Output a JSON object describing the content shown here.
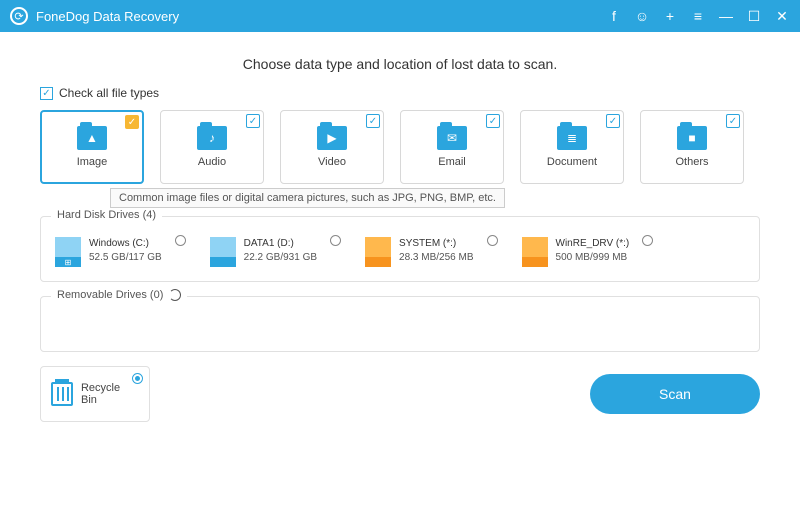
{
  "titlebar": {
    "app_name": "FoneDog Data Recovery"
  },
  "heading": "Choose data type and location of lost data to scan.",
  "check_all_label": "Check all file types",
  "types": [
    {
      "label": "Image",
      "glyph": "▲",
      "selected": true
    },
    {
      "label": "Audio",
      "glyph": "♪",
      "selected": false
    },
    {
      "label": "Video",
      "glyph": "▶",
      "selected": false
    },
    {
      "label": "Email",
      "glyph": "✉",
      "selected": false
    },
    {
      "label": "Document",
      "glyph": "≣",
      "selected": false
    },
    {
      "label": "Others",
      "glyph": "■",
      "selected": false
    }
  ],
  "tooltip": "Common image files or digital camera pictures, such as JPG, PNG, BMP, etc.",
  "hdd": {
    "title": "Hard Disk Drives (4)",
    "drives": [
      {
        "name": "Windows (C:)",
        "size": "52.5 GB/117 GB",
        "color": "blue",
        "badge": "⊞"
      },
      {
        "name": "DATA1 (D:)",
        "size": "22.2 GB/931 GB",
        "color": "blue",
        "badge": ""
      },
      {
        "name": "SYSTEM (*:)",
        "size": "28.3 MB/256 MB",
        "color": "orange",
        "badge": ""
      },
      {
        "name": "WinRE_DRV (*:)",
        "size": "500 MB/999 MB",
        "color": "orange",
        "badge": ""
      }
    ]
  },
  "removable": {
    "title": "Removable Drives (0)"
  },
  "recycle_label": "Recycle Bin",
  "scan_label": "Scan"
}
